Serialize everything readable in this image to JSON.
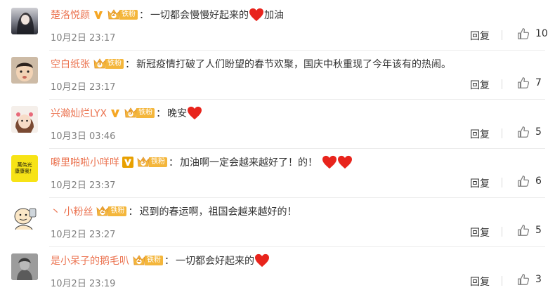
{
  "comments": [
    {
      "name": "楚洛悦颜",
      "vip": true,
      "vip_color": "#f5a623",
      "badge_level": "2",
      "badge_label": "铁粉",
      "text": "一切都会慢慢好起来的",
      "trail_hearts": 1,
      "suffix": "加油",
      "time": "10月2日 23:17",
      "reply": "回复",
      "likes": "10"
    },
    {
      "name": "空白纸张",
      "vip": false,
      "badge_level": "3",
      "badge_label": "铁粉",
      "text": "新冠疫情打破了人们盼望的春节欢聚，国庆中秋重现了今年该有的热闹。",
      "trail_hearts": 0,
      "suffix": "",
      "time": "10月2日 23:17",
      "reply": "回复",
      "likes": "7"
    },
    {
      "name": "兴瀚灿烂LYX",
      "vip": true,
      "vip_color": "#f5a623",
      "badge_level": "5",
      "badge_label": "铁粉",
      "text": "晚安",
      "trail_hearts": 1,
      "suffix": "",
      "time": "10月3日 03:46",
      "reply": "回复",
      "likes": "5"
    },
    {
      "name": "噼里啪啦小咩咩",
      "vip": true,
      "vip_color": "#e8a000",
      "badge_level": "3",
      "badge_label": "铁粉",
      "text": "加油啊一定会越来越好了！的！",
      "trail_hearts": 2,
      "suffix": "",
      "time": "10月2日 23:37",
      "reply": "回复",
      "likes": "6"
    },
    {
      "name": "丶 小粉丝",
      "vip": false,
      "badge_level": "2",
      "badge_label": "铁粉",
      "text": "迟到的春运啊，祖国会越来越好的！",
      "trail_hearts": 0,
      "suffix": "",
      "time": "10月2日 23:27",
      "reply": "回复",
      "likes": "5"
    },
    {
      "name": "是小呆子的鹅毛叭",
      "vip": false,
      "badge_level": "2",
      "badge_label": "铁粉",
      "text": "一切都会好起来的",
      "trail_hearts": 1,
      "suffix": "",
      "time": "10月2日 23:19",
      "reply": "回复",
      "likes": "3"
    }
  ],
  "avatar_4_text": "萬伟光 康康我！",
  "colors": {
    "name": "#eb7350",
    "badge": "#f4b63b",
    "heart": "#e8241c",
    "time": "#808080"
  },
  "icons": {
    "like": "thumbs-up-icon",
    "heart": "heart-icon",
    "badge": "fan-badge-icon",
    "vip": "verified-v-icon"
  }
}
